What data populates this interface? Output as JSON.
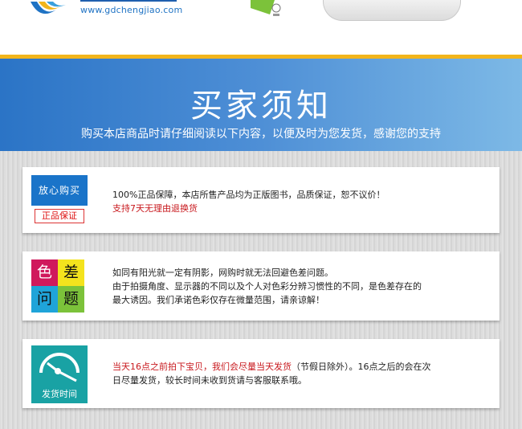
{
  "header": {
    "site_url": "www.gdchengjiao.com"
  },
  "banner": {
    "title": "买家须知",
    "subtitle": "购买本店商品时请仔细阅读以下内容，以便及时为您发货，感谢您的支持"
  },
  "cards": [
    {
      "icon": {
        "name": "genuine-guarantee-icon",
        "top_label": "放心购买",
        "bottom_label": "正品保证"
      },
      "lines": [
        "100%正品保障，本店所售产品均为正版图书，品质保证，恕不议价！",
        "支持7天无理由退换货"
      ]
    },
    {
      "icon": {
        "name": "color-difference-icon",
        "chars": [
          "色",
          "差",
          "问",
          "题"
        ]
      },
      "lines": [
        "如同有阳光就一定有阴影，网购时就无法回避色差问题。",
        "由于拍摄角度、显示器的不同以及个人对色彩分辨习惯性的不同，是色差存在的",
        "最大诱因。我们承诺色彩仅存在微量范围，请亲谅解！"
      ]
    },
    {
      "icon": {
        "name": "shipping-time-icon",
        "label": "发货时间"
      },
      "line1_red": "当天16点之前拍下宝贝，我们会尽量当天发货",
      "line1_rest": "（节假日除外）。16点之后的会在次",
      "line2": "日尽量发货，较长时间未收到货请与客服联系哦。"
    }
  ],
  "colors": {
    "gold": "#f2b51c",
    "banner_blue": "#2b74c6",
    "red_text": "#c8191e",
    "teal": "#19a2a4"
  }
}
